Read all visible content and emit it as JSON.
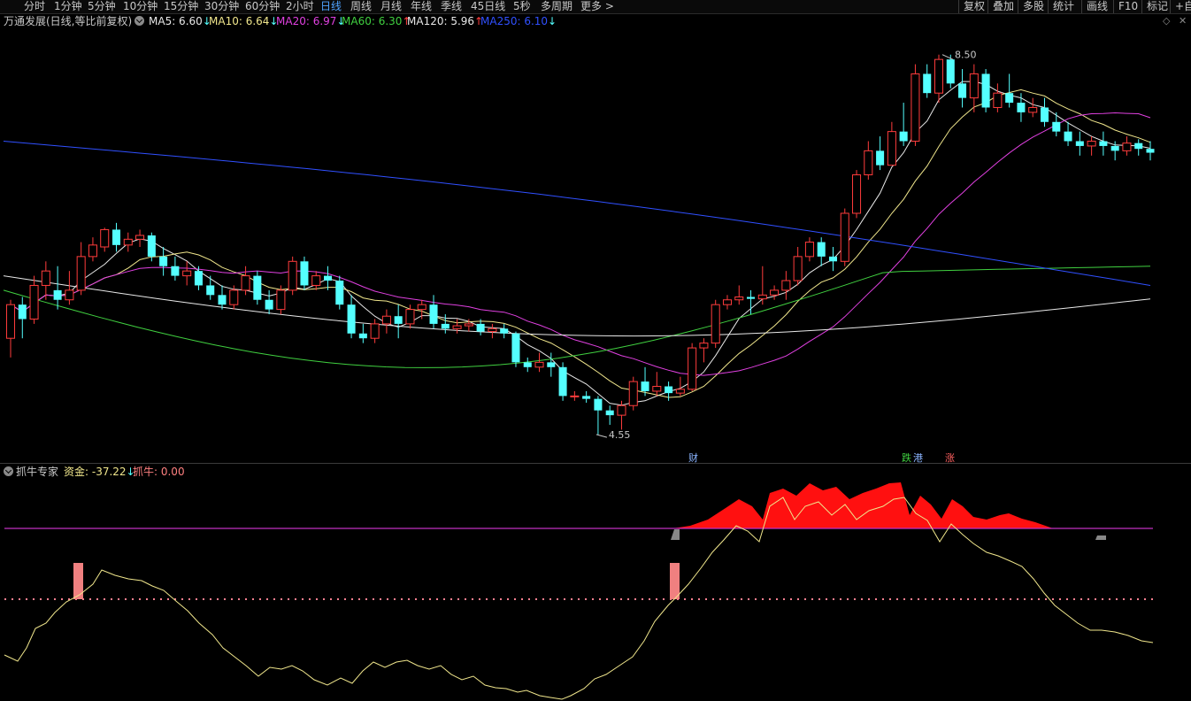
{
  "toolbar": {
    "periods": [
      "分时",
      "1分钟",
      "5分钟",
      "10分钟",
      "15分钟",
      "30分钟",
      "60分钟",
      "2小时",
      "日线",
      "周线",
      "月线",
      "年线",
      "季线",
      "45日线",
      "5秒",
      "多周期",
      "更多 >"
    ],
    "active": "日线",
    "right_items": [
      "复权",
      "叠加",
      "多股",
      "统计",
      "画线",
      "F10",
      "标记",
      "+自"
    ]
  },
  "main_header": {
    "title": "万通发展(日线,等比前复权)",
    "ma": [
      {
        "label": "MA5: 6.60",
        "arrow": "↓",
        "color": "#e8e8e8"
      },
      {
        "label": "MA10: 6.64",
        "arrow": "↓",
        "color": "#f0e68c"
      },
      {
        "label": "MA20: 6.97",
        "arrow": "↓",
        "color": "#e040e0"
      },
      {
        "label": "MA60: 6.30",
        "arrow": "↑",
        "color": "#40d040"
      },
      {
        "label": "MA120: 5.96",
        "arrow": "↑",
        "color": "#e8e8e8"
      },
      {
        "label": "MA250: 6.10",
        "arrow": "↓",
        "color": "#3050ff"
      }
    ]
  },
  "annotations": {
    "high_label": "8.50",
    "low_label": "4.55",
    "events": [
      "财",
      "跌",
      "港",
      "涨"
    ]
  },
  "sub_header": {
    "title": "抓牛专家",
    "fund_label": "资金: -37.22",
    "fund_arrow": "↓",
    "niu_label": "抓牛: 0.00"
  },
  "colors": {
    "up": "#ff3c3c",
    "down": "#54ffff",
    "active": "#4fa3ff"
  },
  "chart_data": {
    "type": "candlestick",
    "price_range": [
      4.3,
      8.7
    ],
    "candles": [
      [
        5.55,
        5.95,
        5.9,
        5.35
      ],
      [
        5.9,
        5.98,
        5.75,
        5.55
      ],
      [
        5.75,
        6.2,
        6.1,
        5.7
      ],
      [
        6.1,
        6.35,
        6.25,
        5.95
      ],
      [
        6.05,
        6.3,
        5.95,
        5.85
      ],
      [
        5.95,
        6.25,
        6.05,
        5.9
      ],
      [
        6.05,
        6.55,
        6.4,
        6.0
      ],
      [
        6.4,
        6.6,
        6.52,
        6.35
      ],
      [
        6.5,
        6.7,
        6.68,
        6.45
      ],
      [
        6.68,
        6.75,
        6.52,
        6.45
      ],
      [
        6.52,
        6.65,
        6.58,
        6.45
      ],
      [
        6.58,
        6.68,
        6.62,
        6.5
      ],
      [
        6.62,
        6.65,
        6.4,
        6.35
      ],
      [
        6.4,
        6.5,
        6.3,
        6.2
      ],
      [
        6.3,
        6.4,
        6.2,
        6.15
      ],
      [
        6.2,
        6.35,
        6.25,
        6.1
      ],
      [
        6.25,
        6.3,
        6.1,
        6.05
      ],
      [
        6.1,
        6.2,
        6.0,
        5.95
      ],
      [
        6.0,
        6.1,
        5.9,
        5.85
      ],
      [
        5.9,
        6.1,
        6.05,
        5.85
      ],
      [
        6.05,
        6.3,
        6.2,
        6.0
      ],
      [
        6.2,
        6.25,
        5.95,
        5.9
      ],
      [
        5.95,
        6.05,
        5.85,
        5.8
      ],
      [
        5.85,
        6.1,
        6.05,
        5.8
      ],
      [
        6.05,
        6.4,
        6.35,
        6.0
      ],
      [
        6.35,
        6.4,
        6.1,
        6.05
      ],
      [
        6.1,
        6.25,
        6.2,
        6.05
      ],
      [
        6.2,
        6.3,
        6.15,
        6.05
      ],
      [
        6.15,
        6.2,
        5.9,
        5.85
      ],
      [
        5.9,
        6.0,
        5.6,
        5.55
      ],
      [
        5.6,
        5.7,
        5.55,
        5.5
      ],
      [
        5.55,
        5.75,
        5.7,
        5.5
      ],
      [
        5.7,
        5.85,
        5.78,
        5.6
      ],
      [
        5.78,
        5.9,
        5.7,
        5.55
      ],
      [
        5.7,
        5.9,
        5.85,
        5.65
      ],
      [
        5.85,
        5.95,
        5.9,
        5.75
      ],
      [
        5.9,
        6.0,
        5.7,
        5.65
      ],
      [
        5.7,
        5.8,
        5.65,
        5.6
      ],
      [
        5.65,
        5.75,
        5.68,
        5.6
      ],
      [
        5.68,
        5.75,
        5.7,
        5.62
      ],
      [
        5.7,
        5.75,
        5.62,
        5.58
      ],
      [
        5.62,
        5.7,
        5.65,
        5.55
      ],
      [
        5.65,
        5.7,
        5.6,
        5.55
      ],
      [
        5.6,
        5.62,
        5.3,
        5.25
      ],
      [
        5.3,
        5.35,
        5.25,
        5.2
      ],
      [
        5.25,
        5.4,
        5.3,
        5.2
      ],
      [
        5.3,
        5.4,
        5.25,
        5.15
      ],
      [
        5.25,
        5.3,
        4.95,
        4.9
      ],
      [
        4.95,
        5.0,
        4.95,
        4.9
      ],
      [
        4.95,
        5.0,
        4.92,
        4.88
      ],
      [
        4.92,
        4.95,
        4.8,
        4.55
      ],
      [
        4.8,
        4.85,
        4.75,
        4.65
      ],
      [
        4.75,
        4.9,
        4.85,
        4.6
      ],
      [
        4.85,
        5.15,
        5.1,
        4.8
      ],
      [
        5.1,
        5.25,
        5.0,
        4.95
      ],
      [
        5.0,
        5.2,
        5.05,
        4.95
      ],
      [
        5.05,
        5.1,
        4.98,
        4.9
      ],
      [
        4.98,
        5.15,
        5.02,
        4.95
      ],
      [
        5.02,
        5.5,
        5.45,
        5.0
      ],
      [
        5.45,
        5.55,
        5.5,
        5.3
      ],
      [
        5.5,
        5.95,
        5.9,
        5.45
      ],
      [
        5.9,
        6.0,
        5.95,
        5.85
      ],
      [
        5.95,
        6.1,
        5.98,
        5.9
      ],
      [
        5.98,
        6.05,
        5.96,
        5.8
      ],
      [
        5.96,
        6.3,
        6.0,
        5.9
      ],
      [
        6.0,
        6.1,
        6.05,
        5.95
      ],
      [
        6.05,
        6.25,
        6.15,
        5.95
      ],
      [
        6.15,
        6.5,
        6.4,
        6.1
      ],
      [
        6.4,
        6.6,
        6.55,
        6.35
      ],
      [
        6.55,
        6.6,
        6.4,
        6.3
      ],
      [
        6.4,
        6.5,
        6.35,
        6.25
      ],
      [
        6.35,
        6.9,
        6.85,
        6.3
      ],
      [
        6.85,
        7.3,
        7.25,
        6.8
      ],
      [
        7.25,
        7.6,
        7.5,
        7.2
      ],
      [
        7.5,
        7.65,
        7.35,
        7.3
      ],
      [
        7.35,
        7.8,
        7.7,
        7.35
      ],
      [
        7.7,
        8.0,
        7.6,
        7.55
      ],
      [
        7.6,
        8.4,
        8.3,
        7.55
      ],
      [
        8.3,
        8.4,
        8.1,
        8.05
      ],
      [
        8.1,
        8.5,
        8.45,
        8.0
      ],
      [
        8.45,
        8.5,
        8.2,
        8.15
      ],
      [
        8.2,
        8.35,
        8.05,
        7.95
      ],
      [
        8.05,
        8.4,
        8.3,
        7.9
      ],
      [
        8.3,
        8.35,
        7.95,
        7.9
      ],
      [
        7.95,
        8.2,
        8.1,
        7.9
      ],
      [
        8.1,
        8.3,
        8.0,
        7.95
      ],
      [
        8.0,
        8.1,
        7.9,
        7.8
      ],
      [
        7.9,
        8.05,
        7.95,
        7.85
      ],
      [
        7.95,
        8.05,
        7.8,
        7.75
      ],
      [
        7.8,
        7.9,
        7.7,
        7.65
      ],
      [
        7.7,
        7.8,
        7.6,
        7.55
      ],
      [
        7.6,
        7.7,
        7.55,
        7.45
      ],
      [
        7.55,
        7.65,
        7.6,
        7.45
      ],
      [
        7.6,
        7.7,
        7.55,
        7.45
      ],
      [
        7.55,
        7.6,
        7.5,
        7.4
      ],
      [
        7.5,
        7.65,
        7.58,
        7.45
      ],
      [
        7.58,
        7.62,
        7.52,
        7.45
      ],
      [
        7.52,
        7.6,
        7.48,
        7.4
      ]
    ],
    "ma_series": [
      {
        "name": "MA5",
        "color": "#e8e8e8",
        "start": 5.65,
        "end": 6.6
      },
      {
        "name": "MA10",
        "color": "#f0e68c",
        "start": 5.6,
        "end": 6.64
      },
      {
        "name": "MA20",
        "color": "#e040e0",
        "start": 5.5,
        "end": 6.97
      },
      {
        "name": "MA60",
        "color": "#40d040",
        "start": 6.05,
        "end": 6.3
      },
      {
        "name": "MA120",
        "color": "#e8e8e8",
        "start": 6.2,
        "end": 5.96
      },
      {
        "name": "MA250",
        "color": "#3050ff",
        "start": 7.6,
        "end": 6.1
      }
    ]
  }
}
